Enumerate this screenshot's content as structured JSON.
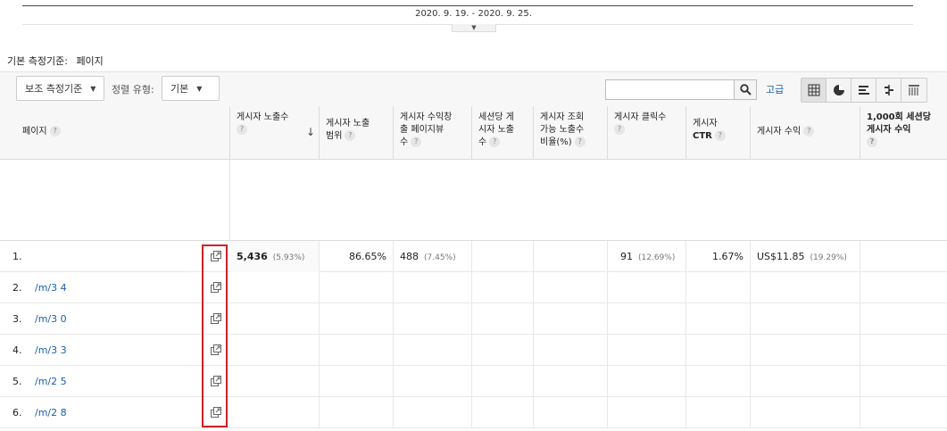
{
  "date_range": "2020. 9. 19. - 2020. 9. 25.",
  "primary_dimension": {
    "label": "기본 측정기준:",
    "value": "페이지"
  },
  "toolbar": {
    "secondary_dim": "보조 측정기준",
    "sort_label": "정렬 유형:",
    "sort_value": "기본",
    "advanced": "고급"
  },
  "headers": {
    "page": "페이지",
    "pub_impressions": "게시자 노출수",
    "pub_coverage": [
      "게시자 노출",
      "범위"
    ],
    "pub_monetized_pv": [
      "게시자 수익창",
      "출 페이지뷰",
      "수"
    ],
    "pub_per_session": [
      "세션당 게",
      "시자 노출",
      "수"
    ],
    "pub_viewable": [
      "게시자 조회",
      "가능 노출수",
      "비율(%)"
    ],
    "pub_clicks": "게시자 클릭수",
    "pub_ctr": [
      "게시자",
      "CTR"
    ],
    "pub_revenue": "게시자 수익",
    "pub_rev_per_1000": [
      "1,000회 세션당",
      "게시자 수익"
    ]
  },
  "rows": [
    {
      "index": "1.",
      "page": "",
      "impressions": "5,436",
      "impressions_pct": "(5.93%)",
      "coverage": "86.65%",
      "monetized_pv": "488",
      "monetized_pv_pct": "(7.45%)",
      "clicks": "91",
      "clicks_pct": "(12.69%)",
      "ctr": "1.67%",
      "revenue": "US$11.85",
      "revenue_pct": "(19.29%)"
    },
    {
      "index": "2.",
      "page": "/m/3   4"
    },
    {
      "index": "3.",
      "page": "/m/3   0"
    },
    {
      "index": "4.",
      "page": "/m/3   3"
    },
    {
      "index": "5.",
      "page": "/m/2   5"
    },
    {
      "index": "6.",
      "page": "/m/2   8"
    }
  ],
  "colors": {
    "link": "#1a5fa8",
    "highlight": "#cc2127"
  }
}
